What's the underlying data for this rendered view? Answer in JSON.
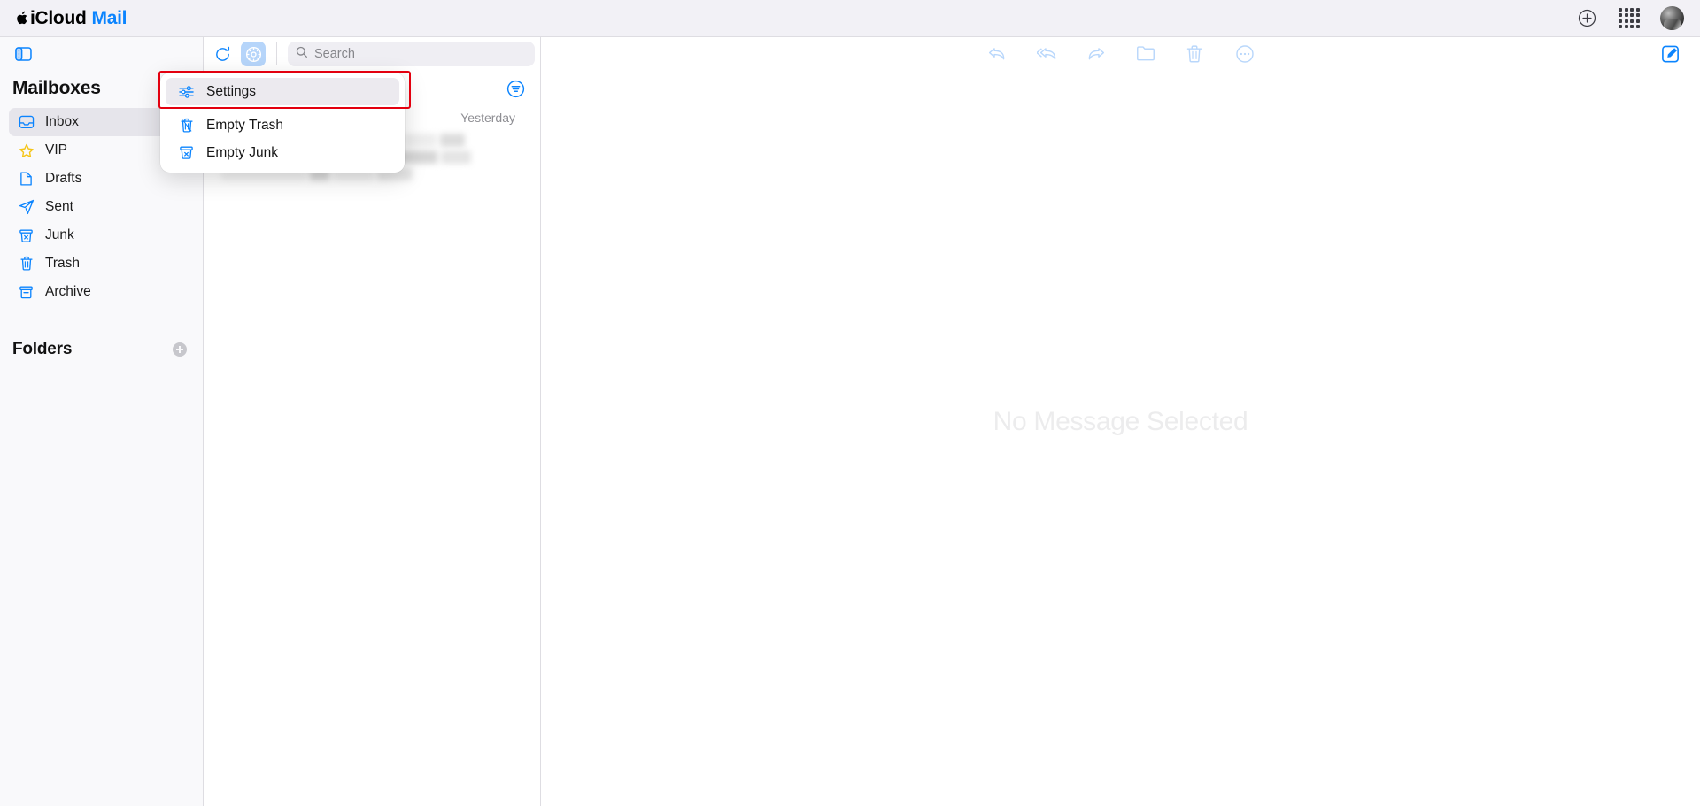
{
  "header": {
    "brand": {
      "apple_glyph": "",
      "icloud": "iCloud",
      "mail": "Mail"
    },
    "icons": [
      {
        "name": "plus-circle-icon",
        "label": "New"
      },
      {
        "name": "app-grid-icon",
        "label": "Apps"
      },
      {
        "name": "avatar",
        "label": "Account"
      }
    ]
  },
  "sidebar": {
    "toggle_name": "sidebar-toggle-icon",
    "title": "Mailboxes",
    "items": [
      {
        "label": "Inbox",
        "icon": "inbox-icon",
        "selected": true
      },
      {
        "label": "VIP",
        "icon": "star-icon",
        "selected": false
      },
      {
        "label": "Drafts",
        "icon": "document-icon",
        "selected": false
      },
      {
        "label": "Sent",
        "icon": "paper-plane-icon",
        "selected": false
      },
      {
        "label": "Junk",
        "icon": "junk-bin-icon",
        "selected": false
      },
      {
        "label": "Trash",
        "icon": "trash-icon",
        "selected": false
      },
      {
        "label": "Archive",
        "icon": "archive-icon",
        "selected": false
      }
    ],
    "folders": {
      "title": "Folders",
      "add_button_name": "add-folder-button"
    }
  },
  "list_panel": {
    "refresh_icon": "refresh-icon",
    "settings_button": {
      "name": "settings-gear-button",
      "icon": "gear-icon",
      "active": true
    },
    "search": {
      "placeholder": "Search",
      "value": "",
      "icon": "search-icon"
    },
    "filter_button": {
      "name": "filter-sort-button",
      "icon": "filter-icon"
    },
    "message": {
      "date": "Yesterday",
      "content_redacted": true
    }
  },
  "reading_pane": {
    "toolbar": [
      {
        "name": "reply-button",
        "icon": "reply-icon"
      },
      {
        "name": "reply-all-button",
        "icon": "reply-all-icon"
      },
      {
        "name": "forward-button",
        "icon": "forward-icon"
      },
      {
        "name": "move-to-folder-button",
        "icon": "folder-icon"
      },
      {
        "name": "delete-button",
        "icon": "trash-icon"
      },
      {
        "name": "more-options-button",
        "icon": "ellipsis-circle-icon"
      }
    ],
    "compose_button": {
      "name": "compose-button",
      "icon": "compose-icon"
    },
    "empty_state": "No Message Selected"
  },
  "menu": {
    "items": [
      {
        "label": "Settings",
        "icon": "sliders-icon",
        "highlighted": true
      },
      {
        "label": "Empty Trash",
        "icon": "trash-icon",
        "highlighted": false
      },
      {
        "label": "Empty Junk",
        "icon": "junk-bin-icon",
        "highlighted": false
      }
    ]
  },
  "colors": {
    "accent_blue": "#0b84fe",
    "toolbar_disabled": "#b9d7fb",
    "header_bg": "#f2f1f6",
    "sidebar_bg": "#f9f9fb",
    "selected_row": "#e6e5eb",
    "highlight_red": "#e3000f",
    "gear_active_bg": "#b6d5fa",
    "star_yellow": "#f5c518"
  }
}
